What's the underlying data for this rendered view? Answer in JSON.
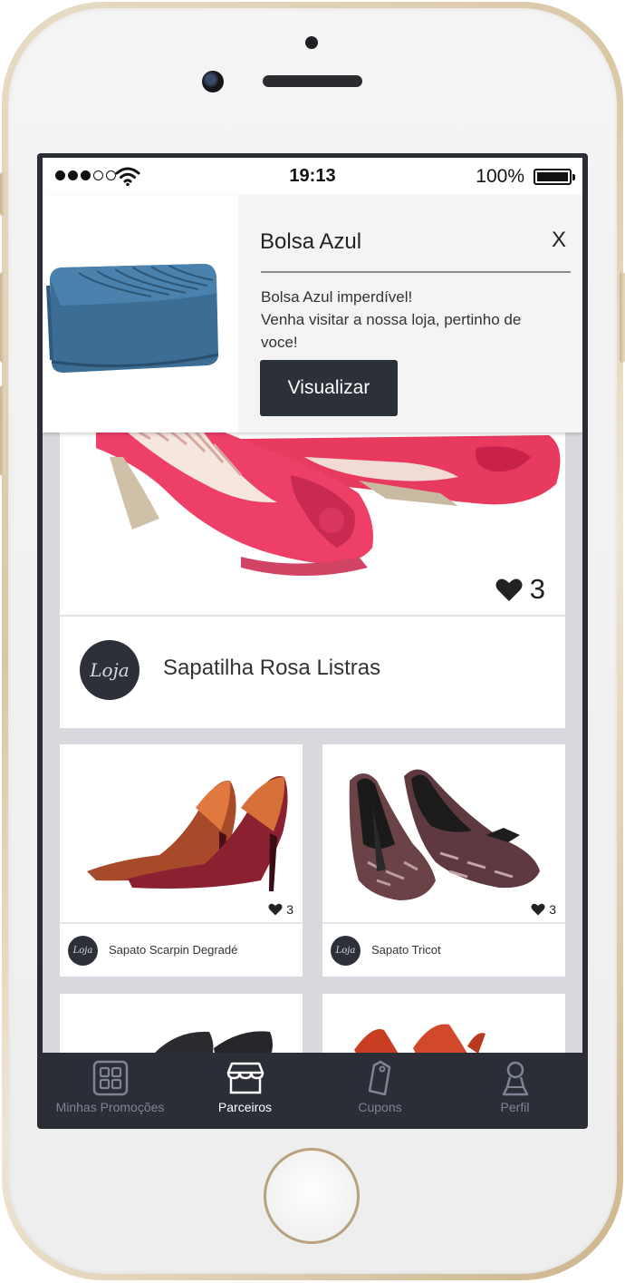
{
  "status_bar": {
    "time": "19:13",
    "battery": "100%"
  },
  "notification": {
    "title": "Bolsa Azul",
    "close_label": "X",
    "body_lines": [
      "Bolsa Azul imperdível!",
      "Venha visitar a nossa loja, pertinho de",
      "voce!"
    ],
    "button_label": "Visualizar",
    "image_icon": "blue-clutch-bag"
  },
  "featured": {
    "likes": "3",
    "store_logo": "Loja",
    "title": "Sapatilha Rosa Listras",
    "image_icon": "pink-wedge-shoes"
  },
  "products": [
    {
      "name": "Sapato Scarpin Degradé",
      "likes": "3",
      "store_logo": "Loja",
      "image_icon": "orange-stiletto-pumps"
    },
    {
      "name": "Sapato Tricot",
      "likes": "3",
      "store_logo": "Loja",
      "image_icon": "tweed-bow-pumps"
    },
    {
      "image_icon": "black-shoes"
    },
    {
      "image_icon": "orange-red-shoes"
    }
  ],
  "tab_bar": {
    "tabs": [
      {
        "label": "Minhas Promoções",
        "icon": "grid-icon",
        "active": false
      },
      {
        "label": "Parceiros",
        "icon": "store-icon",
        "active": true
      },
      {
        "label": "Cupons",
        "icon": "tag-icon",
        "active": false
      },
      {
        "label": "Perfil",
        "icon": "person-icon",
        "active": false
      }
    ]
  },
  "colors": {
    "tab_bar_bg": "#2b2e36",
    "tab_active": "#ffffff",
    "tab_inactive": "#7d8594",
    "button_bg": "#2b3039",
    "feed_bg": "#d8d9de"
  }
}
